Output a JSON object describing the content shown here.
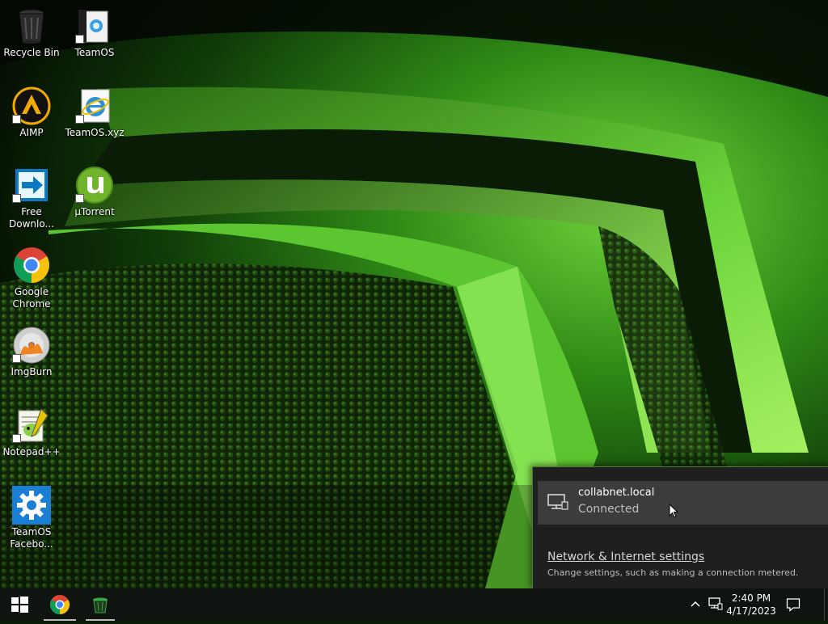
{
  "desktop": {
    "icons": [
      {
        "label": "Recycle Bin",
        "icon": "recycle-bin-icon"
      },
      {
        "label": "TeamOS",
        "icon": "teamos-icon"
      },
      {
        "label": "AIMP",
        "icon": "aimp-icon"
      },
      {
        "label": "TeamOS.xyz",
        "icon": "internet-explorer-icon"
      },
      {
        "label": "Free Downlo...",
        "icon": "free-download-manager-icon"
      },
      {
        "label": "µTorrent",
        "icon": "utorrent-icon"
      },
      {
        "label": "Google Chrome",
        "icon": "chrome-icon"
      },
      {
        "label": "ImgBurn",
        "icon": "imgburn-icon"
      },
      {
        "label": "Notepad++",
        "icon": "notepad-plus-plus-icon"
      },
      {
        "label": "TeamOS Facebo...",
        "icon": "settings-gear-icon"
      }
    ]
  },
  "network_flyout": {
    "network_name": "collabnet.local",
    "status": "Connected",
    "settings_link": "Network & Internet settings",
    "settings_desc": "Change settings, such as making a connection metered."
  },
  "taskbar": {
    "time": "2:40 PM",
    "date": "4/17/2023"
  },
  "colors": {
    "taskbar_bg": "#0f1410",
    "flyout_bg": "#1f1f1f",
    "selected_network_bg": "#3c3c3c",
    "wallpaper_accent": "#7ee04a"
  }
}
